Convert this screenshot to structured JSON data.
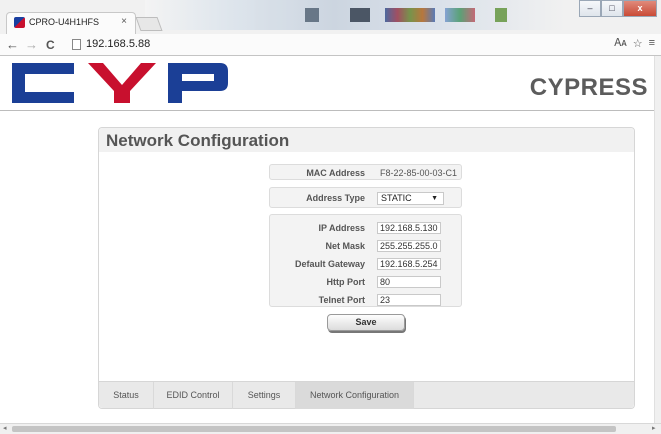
{
  "browser": {
    "tab_title": "CPRO-U4H1HFS",
    "tab_close": "×",
    "url": "192.168.5.88",
    "back": "←",
    "forward": "→",
    "reload": "C",
    "translate_icon": "translate-icon",
    "star_icon": "star-icon",
    "menu_icon": "menu-icon"
  },
  "window_controls": {
    "minimize": "‒",
    "maximize": "□",
    "close": "x"
  },
  "header": {
    "brand": "CYPRESS",
    "logo_colors": {
      "blue": "#1b3f96",
      "red": "#c8102e"
    }
  },
  "panel": {
    "title": "Network Configuration",
    "mac": {
      "label": "MAC Address",
      "value": "F8-22-85-00-03-C1"
    },
    "address_type": {
      "label": "Address Type",
      "value": "STATIC",
      "arrow": "▼"
    },
    "ip": {
      "label": "IP Address",
      "value": "192.168.5.130"
    },
    "mask": {
      "label": "Net Mask",
      "value": "255.255.255.0"
    },
    "gateway": {
      "label": "Default Gateway",
      "value": "192.168.5.254"
    },
    "http_port": {
      "label": "Http Port",
      "value": "80"
    },
    "telnet_port": {
      "label": "Telnet Port",
      "value": "23"
    },
    "save_label": "Save"
  },
  "tabs": [
    "Status",
    "EDID Control",
    "Settings",
    "Network Configuration"
  ],
  "active_tab": "Network Configuration",
  "scroll": {
    "left_arrow": "◂",
    "right_arrow": "▸"
  }
}
